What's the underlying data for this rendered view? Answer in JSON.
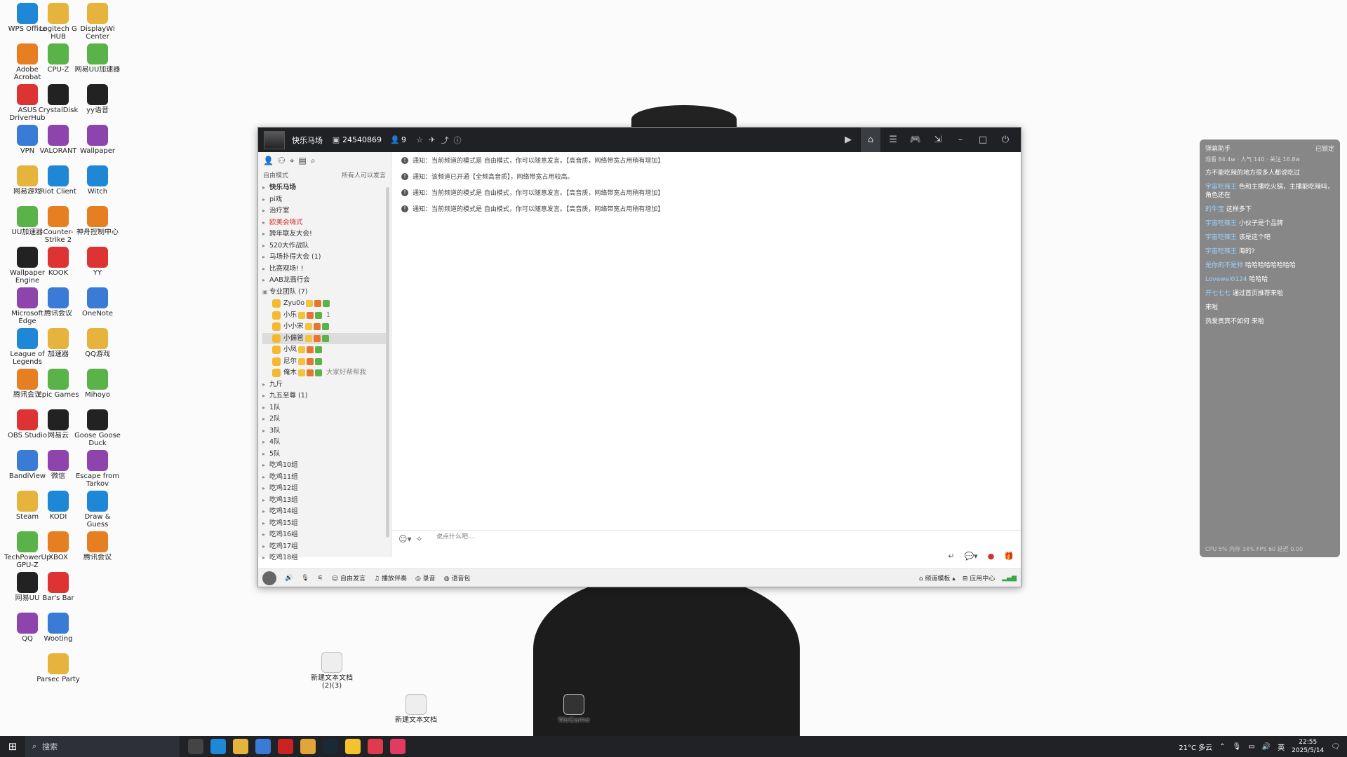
{
  "desktop": {
    "icons_col1": [
      "WPS Office",
      "Adobe Acrobat",
      "ASUS DriverHub",
      "VPN",
      "网易游戏",
      "UU加速器",
      "Wallpaper Engine",
      "Microsoft Edge",
      "League of Legends",
      "腾讯会议",
      "OBS Studio",
      "BandiView",
      "Steam",
      "TechPowerUp GPU-Z",
      "网易UU",
      "QQ"
    ],
    "icons_col2": [
      "Logitech G HUB",
      "CPU-Z",
      "CrystalDisk",
      "VALORANT",
      "Riot Client",
      "Counter-Strike 2",
      "KOOK",
      "腾讯会议",
      "加速器",
      "Epic Games",
      "网易云",
      "微信",
      "KODI",
      "XBOX",
      "Bar's Bar",
      "Wooting",
      "Parsec Party"
    ],
    "icons_col3": [
      "DisplayWi Center",
      "网易UU加速器",
      "yy语音",
      "Wallpaper",
      "Witch",
      "神舟控制中心",
      "YY",
      "OneNote",
      "QQ游戏",
      "Mihoyo",
      "Goose Goose Duck",
      "Escape from Tarkov",
      "Draw & Guess",
      "腾讯会议"
    ],
    "bottom_icons": [
      "新建文本文档 (2)(3)",
      "新建文本文档",
      "WeGame"
    ]
  },
  "window": {
    "channel_name": "快乐马场",
    "channel_id": "24540869",
    "member_count": "9",
    "mode_label": "自由模式",
    "mode_hint": "所有人可以发言",
    "tree": [
      {
        "label": "快乐马场",
        "type": "root"
      },
      {
        "label": "pi戏",
        "type": "ch"
      },
      {
        "label": "治疗室",
        "type": "ch"
      },
      {
        "label": "欧美会嗨式",
        "type": "ch",
        "red": true
      },
      {
        "label": "跨年联友大会!",
        "type": "ch"
      },
      {
        "label": "520大作战队",
        "type": "ch"
      },
      {
        "label": "马场扑得大会 (1)",
        "type": "ch"
      },
      {
        "label": "比赛观场! !",
        "type": "ch"
      },
      {
        "label": "AAB龙翡行会",
        "type": "ch"
      },
      {
        "label": "专业团队 (7)",
        "type": "ch",
        "open": true
      }
    ],
    "users": [
      {
        "name": "Zyu0o",
        "extra": ""
      },
      {
        "name": "小乐",
        "extra": "1"
      },
      {
        "name": "小小宋",
        "extra": ""
      },
      {
        "name": "小偏爸",
        "extra": "",
        "sel": true
      },
      {
        "name": "小凤",
        "extra": ""
      },
      {
        "name": "尼尔",
        "extra": ""
      },
      {
        "name": "俺木",
        "extra": "大家好帮帮我"
      }
    ],
    "tree2": [
      "九斤",
      "九五至尊 (1)",
      "1队",
      "2队",
      "3队",
      "4队",
      "5队",
      "吃鸡10组",
      "吃鸡11组",
      "吃鸡12组",
      "吃鸡13组",
      "吃鸡14组",
      "吃鸡15组",
      "吃鸡16组",
      "吃鸡17组",
      "吃鸡18组"
    ],
    "notices": [
      "通知：当前频道的模式是 自由模式，你可以随意发言。【高音质，网络带宽占用稍有增加】",
      "通知：该频道已开通【全频高音质】，网络带宽占用较高。",
      "通知：当前频道的模式是 自由模式，你可以随意发言。【高音质，网络带宽占用稍有增加】",
      "通知：当前频道的模式是 自由模式，你可以随意发言。【高音质，网络带宽占用稍有增加】"
    ],
    "input_placeholder": "说点什么吧...",
    "bottom": {
      "free_speak": "自由发言",
      "accompany": "播放伴奏",
      "record": "录音",
      "voice_pack": "语音包",
      "channel_settings": "频道模板",
      "app_center": "应用中心"
    }
  },
  "overlay": {
    "title": "弹幕助手",
    "lock": "已锁定",
    "stats": [
      "观看 84.4w",
      "人气 140",
      "关注 16.8w"
    ],
    "messages": [
      {
        "user": "",
        "text": "方不能吃辣的地方很多人都说吃过"
      },
      {
        "user": "宇宙吃辣王",
        "text": "色和主播吃火锅，主播能吃辣吗，角色还在"
      },
      {
        "user": "的牛宝",
        "text": "这样多下"
      },
      {
        "user": "宇宙吃辣王",
        "text": "小伙子是个品牌"
      },
      {
        "user": "宇宙吃辣王",
        "text": "该是这个吧"
      },
      {
        "user": "宇宙吃辣王",
        "text": "海的?"
      },
      {
        "user": "是你的不是帅",
        "text": "哈哈哈哈哈哈哈哈"
      },
      {
        "user": "Lovewei0124",
        "text": "哈哈哈"
      },
      {
        "user": "开七七七",
        "text": "通过首页推荐来啦"
      },
      {
        "user": "",
        "text": "来啦"
      },
      {
        "user": "",
        "text": "热爱贵宾不如何 来啦"
      }
    ],
    "footer": "CPU 5% 内存 34% FPS 60 延迟 0.00"
  },
  "taskbar": {
    "search": "搜索",
    "weather": "21°C 多云",
    "lang": "英",
    "time": "22:55",
    "date": "2025/5/14"
  }
}
